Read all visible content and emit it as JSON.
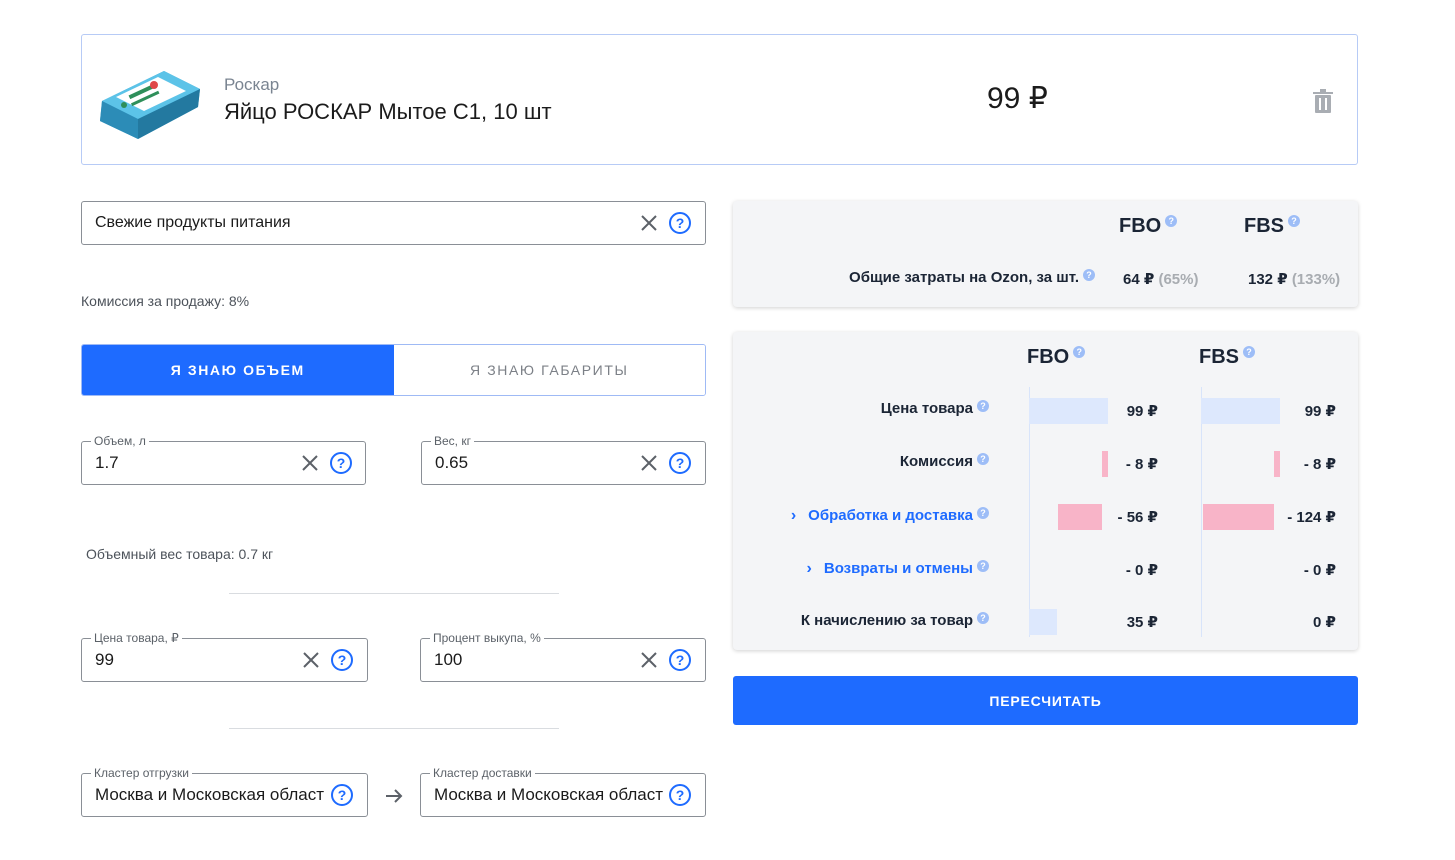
{
  "product": {
    "brand": "Роскар",
    "title": "Яйцо РОСКАР Мытое С1, 10 шт",
    "price": "99 ₽"
  },
  "category": {
    "value": "Свежие продукты питания",
    "commission_hint": "Комиссия за продажу: 8%"
  },
  "mode_toggle": {
    "volume_label": "Я ЗНАЮ ОБЪЕМ",
    "dimensions_label": "Я ЗНАЮ ГАБАРИТЫ"
  },
  "volume": {
    "legend": "Объем, л",
    "value": "1.7"
  },
  "weight": {
    "legend": "Вес, кг",
    "value": "0.65"
  },
  "volumetric_hint": "Объемный вес товара: 0.7 кг",
  "price_field": {
    "legend": "Цена товара, ₽",
    "value": "99"
  },
  "buyout_field": {
    "legend": "Процент выкупа, %",
    "value": "100"
  },
  "ship_cluster": {
    "legend": "Кластер отгрузки",
    "value": "Москва и Московская область"
  },
  "delivery_cluster": {
    "legend": "Кластер доставки",
    "value": "Москва и Московская область"
  },
  "summary": {
    "fbo_label": "FBO",
    "fbs_label": "FBS",
    "row_label": "Общие затраты на Ozon, за шт.",
    "fbo_value": "64 ₽",
    "fbo_pct": "(65%)",
    "fbs_value": "132 ₽",
    "fbs_pct": "(133%)"
  },
  "breakdown": {
    "fbo_label": "FBO",
    "fbs_label": "FBS",
    "rows": [
      {
        "label": "Цена товара",
        "fbo": "99 ₽",
        "fbs": "99 ₽"
      },
      {
        "label": "Комиссия",
        "fbo": "- 8 ₽",
        "fbs": "- 8 ₽"
      },
      {
        "label": "Обработка и доставка",
        "fbo": "- 56 ₽",
        "fbs": "- 124 ₽"
      },
      {
        "label": "Возвраты и отмены",
        "fbo": "- 0 ₽",
        "fbs": "- 0 ₽"
      },
      {
        "label": "К начислению за товар",
        "fbo": "35 ₽",
        "fbs": "0 ₽"
      }
    ]
  },
  "recalc_label": "ПЕРЕСЧИТАТЬ",
  "colors": {
    "accent": "#1e6bff",
    "positive_bar": "#dde8fd",
    "negative_bar": "#f8b4c8"
  }
}
